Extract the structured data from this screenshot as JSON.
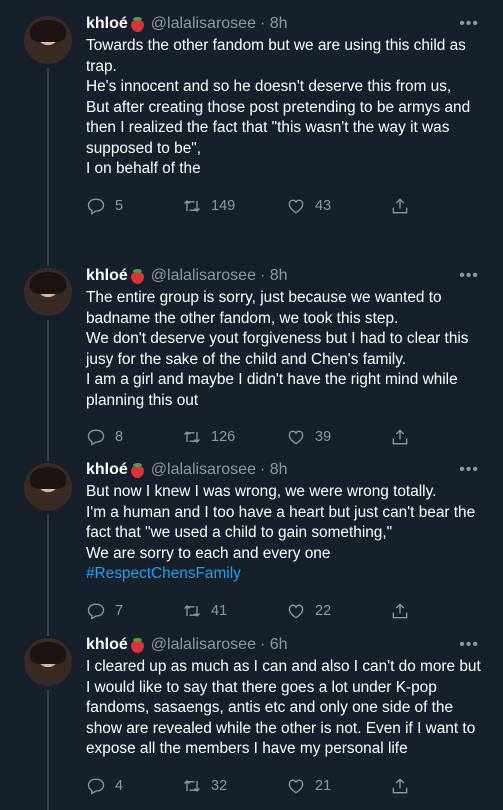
{
  "tweets": [
    {
      "name": "khloé",
      "handle": "@lalalisarosee",
      "time": "· 8h",
      "more": "•••",
      "lines": [
        "Towards the other fandom but we are using this child as trap.",
        "He's innocent and so he doesn't deserve this from us,",
        "But after creating those post pretending to be armys and then I realized the fact that \"this wasn't the way it was supposed to be\",",
        "I on behalf of the"
      ],
      "hashtag": "",
      "replies": "5",
      "retweets": "149",
      "likes": "43"
    },
    {
      "name": "khloé",
      "handle": "@lalalisarosee",
      "time": "· 8h",
      "more": "•••",
      "lines": [
        "The entire group is sorry, just because we wanted to badname the other fandom, we took this step.",
        "We don't deserve yout forgiveness but I had to clear this jusy for the sake of the child and Chen's family.",
        "I am a girl and maybe I didn't have the right mind while planning this out"
      ],
      "hashtag": "",
      "replies": "8",
      "retweets": "126",
      "likes": "39"
    },
    {
      "name": "khloé",
      "handle": "@lalalisarosee",
      "time": "· 8h",
      "more": "•••",
      "lines": [
        "But now I knew I was wrong, we were wrong totally.",
        "I'm a human and I too have a heart but just can't bear the fact that \"we used a child to gain something,\"",
        "We are sorry to each and every one"
      ],
      "hashtag": "#RespectChensFamily",
      "replies": "7",
      "retweets": "41",
      "likes": "22"
    },
    {
      "name": "khloé",
      "handle": "@lalalisarosee",
      "time": "· 6h",
      "more": "•••",
      "lines": [
        "I cleared up as much as I can and also I can't do more but I would like to say that there goes a lot under K-pop fandoms, sasaengs, antis etc and only one side of the show are revealed while the other is not. Even if I want to expose all the members I have my personal life"
      ],
      "hashtag": "",
      "replies": "4",
      "retweets": "32",
      "likes": "21"
    }
  ],
  "icons": [
    "reply-icon",
    "retweet-icon",
    "like-icon",
    "share-icon",
    "strawberry-emoji"
  ],
  "colors": {
    "background": "#15202b",
    "secondary_text": "#8899a6",
    "link": "#1da1f2",
    "thread_line": "#38444d"
  }
}
